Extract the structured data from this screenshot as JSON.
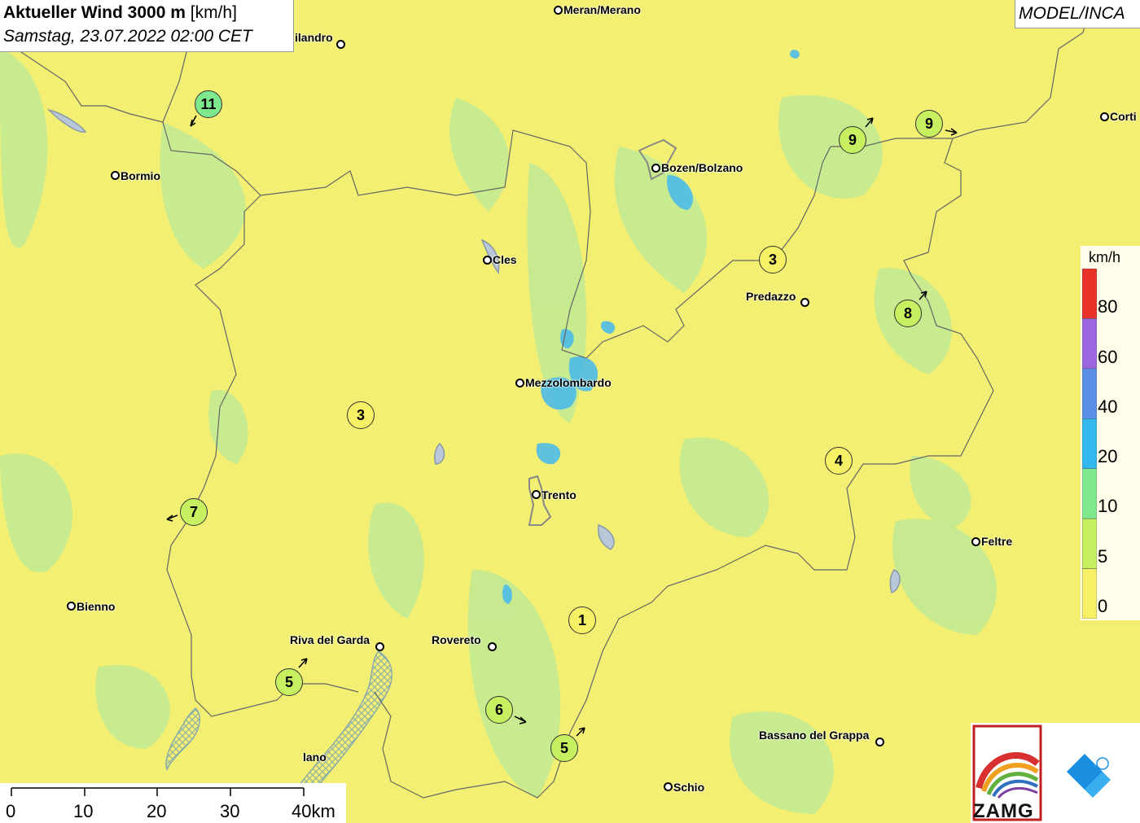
{
  "title": {
    "bold": "Aktueller Wind 3000 m",
    "unit": "[km/h]",
    "datetime": "Samstag, 23.07.2022 02:00 CET"
  },
  "model_label": "MODEL/INCA",
  "cities": [
    {
      "name": "Meran/Merano"
    },
    {
      "name": "ilandro"
    },
    {
      "name": "Bormio"
    },
    {
      "name": "Bozen/Bolzano"
    },
    {
      "name": "Corti"
    },
    {
      "name": "Cles"
    },
    {
      "name": "Predazzo"
    },
    {
      "name": "Mezzolombardo"
    },
    {
      "name": "Trento"
    },
    {
      "name": "Feltre"
    },
    {
      "name": "Bienno"
    },
    {
      "name": "Riva del Garda"
    },
    {
      "name": "Rovereto"
    },
    {
      "name": "Bassano del Grappa"
    },
    {
      "name": "Schio"
    },
    {
      "name": "lano"
    }
  ],
  "wind_stations": [
    {
      "value": "11",
      "color": "#7ee88c",
      "direction": "SW"
    },
    {
      "value": "9",
      "color": "#c6f060",
      "direction": "NE"
    },
    {
      "value": "9",
      "color": "#c6f060",
      "direction": "E"
    },
    {
      "value": "3",
      "color": "#f5f065",
      "direction": ""
    },
    {
      "value": "8",
      "color": "#c6f060",
      "direction": "NE"
    },
    {
      "value": "3",
      "color": "#f5f065",
      "direction": ""
    },
    {
      "value": "4",
      "color": "#f5f065",
      "direction": ""
    },
    {
      "value": "7",
      "color": "#c6f060",
      "direction": "W"
    },
    {
      "value": "1",
      "color": "#f5f065",
      "direction": ""
    },
    {
      "value": "5",
      "color": "#c6f060",
      "direction": "NE"
    },
    {
      "value": "6",
      "color": "#c6f060",
      "direction": "E"
    },
    {
      "value": "5",
      "color": "#c6f060",
      "direction": "NE"
    }
  ],
  "scale_bar": {
    "labels": [
      "0",
      "10",
      "20",
      "30",
      "40km"
    ]
  },
  "legend": {
    "title": "km/h",
    "labels": [
      "80",
      "60",
      "40",
      "20",
      "10",
      "5",
      "0"
    ],
    "colors": [
      "#e8322a",
      "#9b66e0",
      "#5b8fe8",
      "#33b8ee",
      "#7ee88c",
      "#c6f060",
      "#f5f065"
    ]
  },
  "logo": {
    "text": "ZAMG"
  }
}
